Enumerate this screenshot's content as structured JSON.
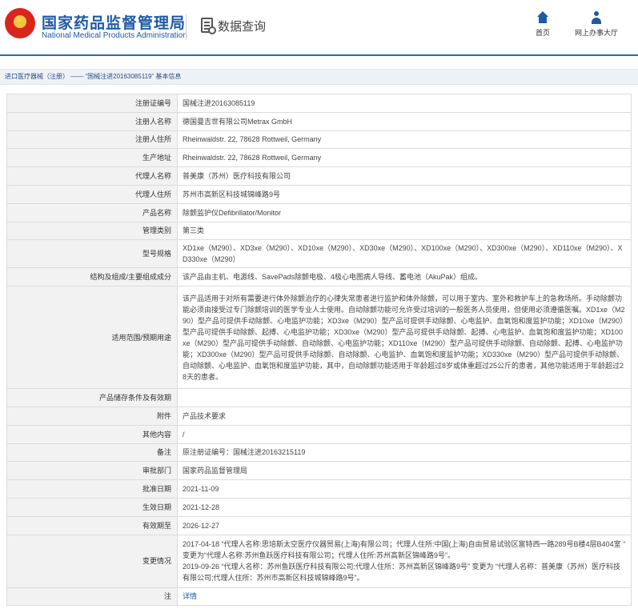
{
  "header": {
    "agency_cn": "国家药品监督管理局",
    "agency_en": "National Medical Products Administration",
    "query_title": "数据查询",
    "nav": [
      {
        "label": "首页",
        "icon": "home-icon"
      },
      {
        "label": "网上办事大厅",
        "icon": "person-icon"
      }
    ]
  },
  "breadcrumb": {
    "part1": "进口医疗器械（注册）",
    "sep": " —— ",
    "part2": "“国械注进20163085119”",
    "part3": " 基本信息"
  },
  "rows": [
    {
      "label": "注册证编号",
      "value": "国械注进20163085119"
    },
    {
      "label": "注册人名称",
      "value": "德国曼吉世有限公司Metrax GmbH"
    },
    {
      "label": "注册人住所",
      "value": "Rheinwaldstr. 22, 78628 Rottweil, Germany"
    },
    {
      "label": "生产地址",
      "value": "Rheinwaldstr. 22, 78628 Rottweil, Germany"
    },
    {
      "label": "代理人名称",
      "value": "普美康（苏州）医疗科技有限公司"
    },
    {
      "label": "代理人住所",
      "value": "苏州市高新区科技城锦峰路9号"
    },
    {
      "label": "产品名称",
      "value": "除颤监护仪Defibrillator/Monitor"
    },
    {
      "label": "管理类别",
      "value": "第三类"
    },
    {
      "label": "型号规格",
      "value": "XD1xe（M290）、XD3xe（M290）、XD10xe（M290）、XD30xe（M290）、XD100xe（M290）、XD300xe（M290）、XD110xe（M290）、XD330xe（M290）"
    },
    {
      "label": "结构及组成/主要组成成分",
      "value": "该产品由主机、电源线、SavePads除颤电极、4极心电图病人导线、蓄电池（AkuPak）组成。"
    },
    {
      "label": "适用范围/预期用途",
      "value": "该产品适用于对所有需要进行体外除颤治疗的心律失常患者进行监护和体外除颤，可以用于室内、室外和救护车上的急救场所。手动除颤功能必须由接受过专门除颤培训的医学专业人士使用。自动除颤功能可允许受过培训的一般医务人员使用，但使用必须遵循医嘱。XD1xe（M290）型产品可提供手动除颤、心电监护功能；XD3xe（M290）型产品可提供手动除颤、心电监护、血氧饱和度监护功能；XD10xe（M290）型产品可提供手动除颤、起搏、心电监护功能；XD30xe（M290）型产品可提供手动除颤、起搏、心电监护、血氧饱和度监护功能；XD100xe（M290）型产品可提供手动除颤、自动除颤、心电监护功能；XD110xe（M290）型产品可提供手动除颤、自动除颤、起搏、心电监护功能；XD300xe（M290）型产品可提供手动除颤、自动除颤、心电监护、血氧饱和度监护功能；XD330xe（M290）型产品可提供手动除颤、自动除颤、心电监护、血氧饱和度监护功能，其中，自动除颤功能适用于年龄超过8岁或体重超过25公斤的患者，其他功能适用于年龄超过28天的患者。"
    },
    {
      "label": "产品储存条件及有效期",
      "value": ""
    },
    {
      "label": "附件",
      "value": "产品技术要求"
    },
    {
      "label": "其他内容",
      "value": "/"
    },
    {
      "label": "备注",
      "value": "原注册证编号：国械注进20163215119"
    },
    {
      "label": "审批部门",
      "value": "国家药品监督管理局"
    },
    {
      "label": "批准日期",
      "value": "2021-11-09"
    },
    {
      "label": "生效日期",
      "value": "2021-12-28"
    },
    {
      "label": "有效期至",
      "value": "2026-12-27"
    },
    {
      "label": "变更情况",
      "value": "2017-04-18 “代理人名称:思培斯太空医疗仪器贸易(上海)有限公司；代理人住所:中国(上海)自由贸易试验区富特西一路289号B楼4层B404室 ” 变更为“代理人名称:苏州鱼跃医疗科技有限公司；代理人住所:苏州高新区锦峰路9号”。\n2019-09-26 “代理人名称：苏州鱼跃医疗科技有限公司;代理人住所：苏州高新区锦峰路9号” 变更为 “代理人名称：普美康（苏州）医疗科技有限公司;代理人住所：苏州市高新区科技城锦峰路9号”。"
    },
    {
      "label": "注",
      "value": "详情"
    }
  ]
}
